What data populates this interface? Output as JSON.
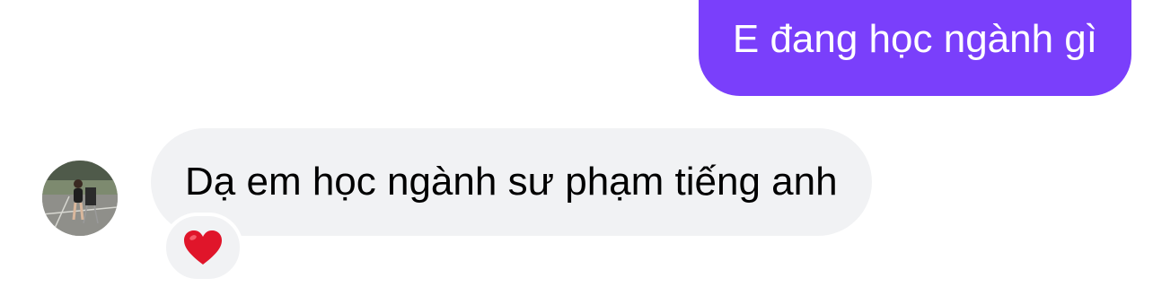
{
  "conversation": {
    "outgoing_message": {
      "text": "E đang học ngành gì",
      "bubble_color": "#7a3ffb"
    },
    "incoming_message": {
      "text": "Dạ em học ngành sư phạm tiếng anh",
      "bubble_color": "#f1f2f4",
      "reaction": "heart-icon",
      "reaction_color": "#e0152a"
    },
    "sender_avatar": "profile-photo"
  }
}
